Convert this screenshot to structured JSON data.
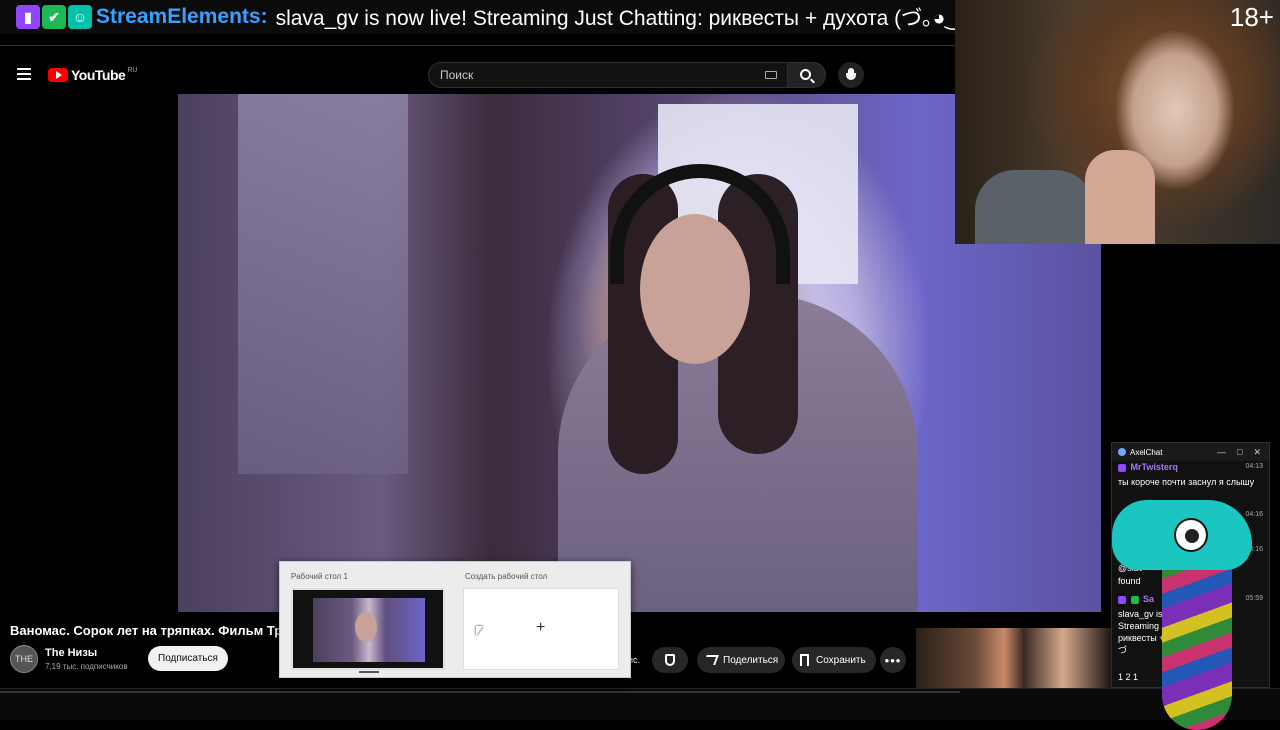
{
  "ticker": {
    "name": "StreamElements:",
    "message": "slava_gv is now live! Streaming Just Chatting: риквесты + духота (づ｡◕‿‿◕｡)づ",
    "age": "18+"
  },
  "youtube": {
    "logo_text": "YouTube",
    "region": "RU",
    "search_placeholder": "Поиск"
  },
  "video": {
    "title": "Ваномас. Сорок лет на тряпках. Фильм Тр",
    "channel_avatar": "THE",
    "channel_name": "The Низы",
    "channel_subs": "7,19 тыс. подписчиков",
    "subscribe_label": "Подписаться",
    "cut_text": "ис.",
    "share_label": "Поделиться",
    "save_label": "Сохранить",
    "more_label": "•••"
  },
  "switcher": {
    "desktop1_label": "Рабочий стол 1",
    "new_desktop_label": "Создать рабочий стол",
    "plus": "+"
  },
  "chat": {
    "title": "AxelChat",
    "ctrl_min": "—",
    "ctrl_max": "□",
    "ctrl_close": "✕",
    "messages": [
      {
        "author": "MrTwisterq",
        "time": "04:13",
        "text": "ты короче почти заснул я слышу"
      },
      {
        "author": "",
        "time": "04:16",
        "text": ""
      },
      {
        "author": "",
        "time": "04:16",
        "text": "@slav"
      },
      {
        "author": "",
        "time": "",
        "text": "found"
      },
      {
        "author": "Sa",
        "time": "05:59",
        "text": "slava_gv is no Streaming Jus риквесты + ду •‿‿•｡)づ"
      },
      {
        "author": "",
        "time": "",
        "text": "1 2 1"
      }
    ]
  },
  "colors": {
    "twitch": "#9146ff",
    "streamelements": "#38a1ff",
    "youtube_red": "#ff0000",
    "chat_author": "#a675ff"
  }
}
